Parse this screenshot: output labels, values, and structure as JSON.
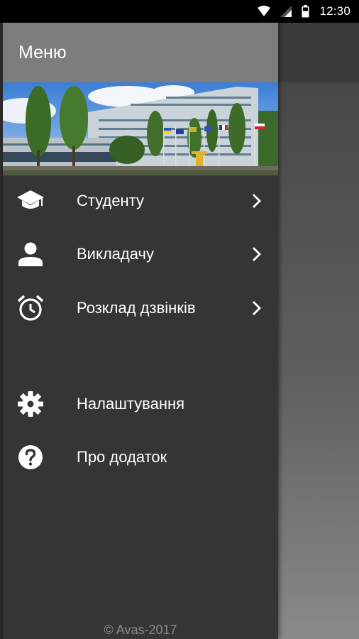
{
  "status_bar": {
    "time": "12:30",
    "icons": [
      "wifi-icon",
      "signal-icon",
      "battery-icon"
    ]
  },
  "drawer": {
    "title": "Меню",
    "banner": "university-building-photo",
    "items": [
      {
        "label": "Студенту",
        "icon": "graduation-cap-icon",
        "has_submenu": true
      },
      {
        "label": "Викладачу",
        "icon": "person-icon",
        "has_submenu": true
      },
      {
        "label": "Розклад дзвінків",
        "icon": "alarm-clock-icon",
        "has_submenu": true
      },
      {
        "label": "Налаштування",
        "icon": "gear-icon",
        "has_submenu": false
      },
      {
        "label": "Про додаток",
        "icon": "help-icon",
        "has_submenu": false
      }
    ],
    "footer": "© Avas-2017"
  },
  "colors": {
    "drawer_bg": "#353535",
    "header_bg": "#7d7d7d",
    "status_bar_bg": "#000000",
    "text": "#ffffff",
    "footer_text": "#8a8a8a"
  }
}
